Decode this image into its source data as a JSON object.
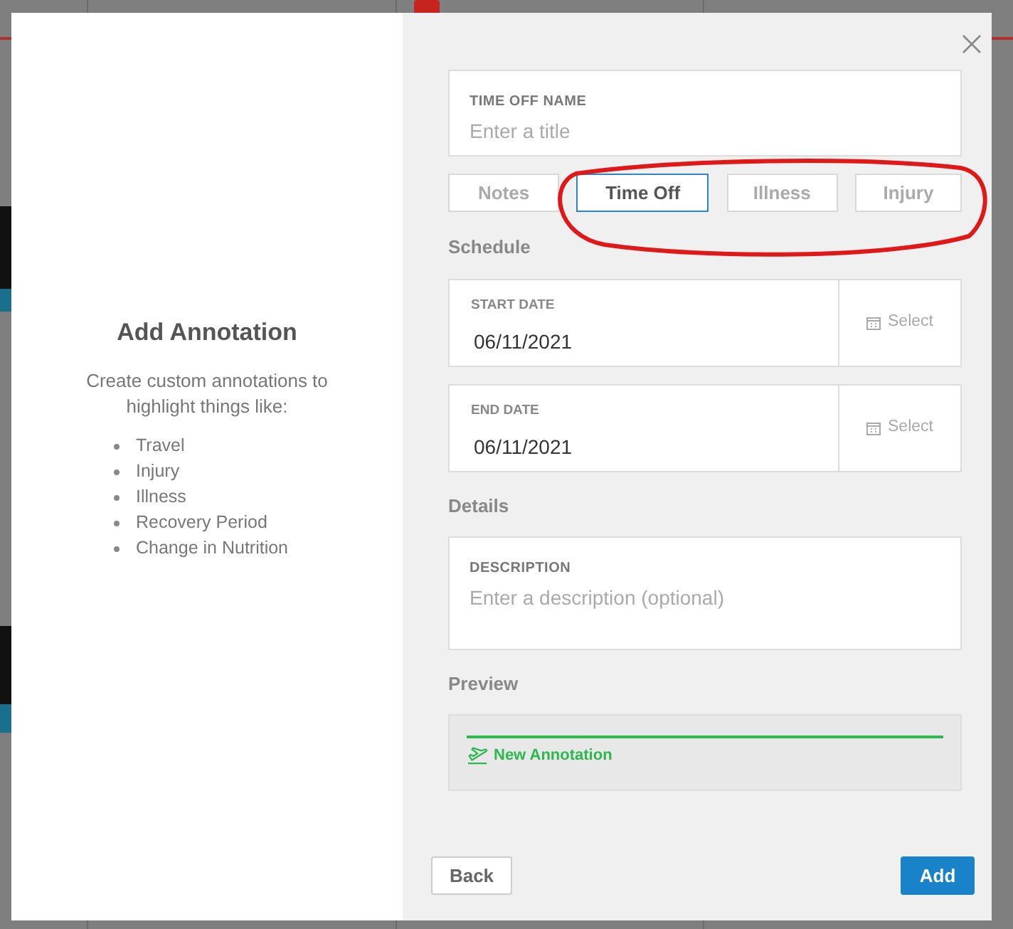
{
  "intro": {
    "title": "Add Annotation",
    "text": "Create custom annotations to highlight things like:",
    "items": [
      "Travel",
      "Injury",
      "Illness",
      "Recovery Period",
      "Change in Nutrition"
    ]
  },
  "form": {
    "name_field": {
      "label": "TIME OFF NAME",
      "placeholder": "Enter a title"
    },
    "types": [
      {
        "label": "Notes",
        "selected": false
      },
      {
        "label": "Time Off",
        "selected": true
      },
      {
        "label": "Illness",
        "selected": false
      },
      {
        "label": "Injury",
        "selected": false
      }
    ],
    "schedule_heading": "Schedule",
    "dates": [
      {
        "label": "START DATE",
        "value": "06/11/2021",
        "button": "Select"
      },
      {
        "label": "END DATE",
        "value": "06/11/2021",
        "button": "Select"
      }
    ],
    "details_heading": "Details",
    "description": {
      "label": "DESCRIPTION",
      "placeholder": "Enter a description (optional)"
    },
    "preview_heading": "Preview",
    "preview": {
      "label": "New Annotation",
      "color": "#2db84d"
    }
  },
  "buttons": {
    "back": "Back",
    "add": "Add"
  }
}
